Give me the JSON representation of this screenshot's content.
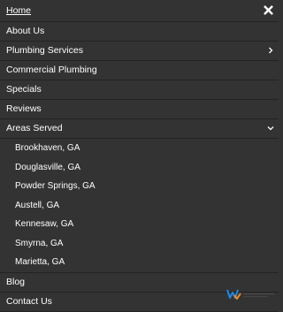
{
  "menu": {
    "home": "Home",
    "about": "About Us",
    "plumbing": "Plumbing Services",
    "commercial": "Commercial Plumbing",
    "specials": "Specials",
    "reviews": "Reviews",
    "areas": "Areas Served",
    "areas_list": [
      "Brookhaven, GA",
      "Douglasville, GA",
      "Powder Springs, GA",
      "Austell, GA",
      "Kennesaw, GA",
      "Smyrna, GA",
      "Marietta, GA"
    ],
    "blog": "Blog",
    "contact": "Contact Us"
  },
  "icons": {
    "close": "close-icon",
    "submenu_closed": "chevron-right-icon",
    "submenu_open": "chevron-down-icon",
    "badge": "brand-badge-icon"
  },
  "colors": {
    "background": "#333333",
    "divider": "#232323",
    "text": "#ffffff",
    "badge_blue": "#1e88e5",
    "badge_orange": "#f28c1e"
  }
}
